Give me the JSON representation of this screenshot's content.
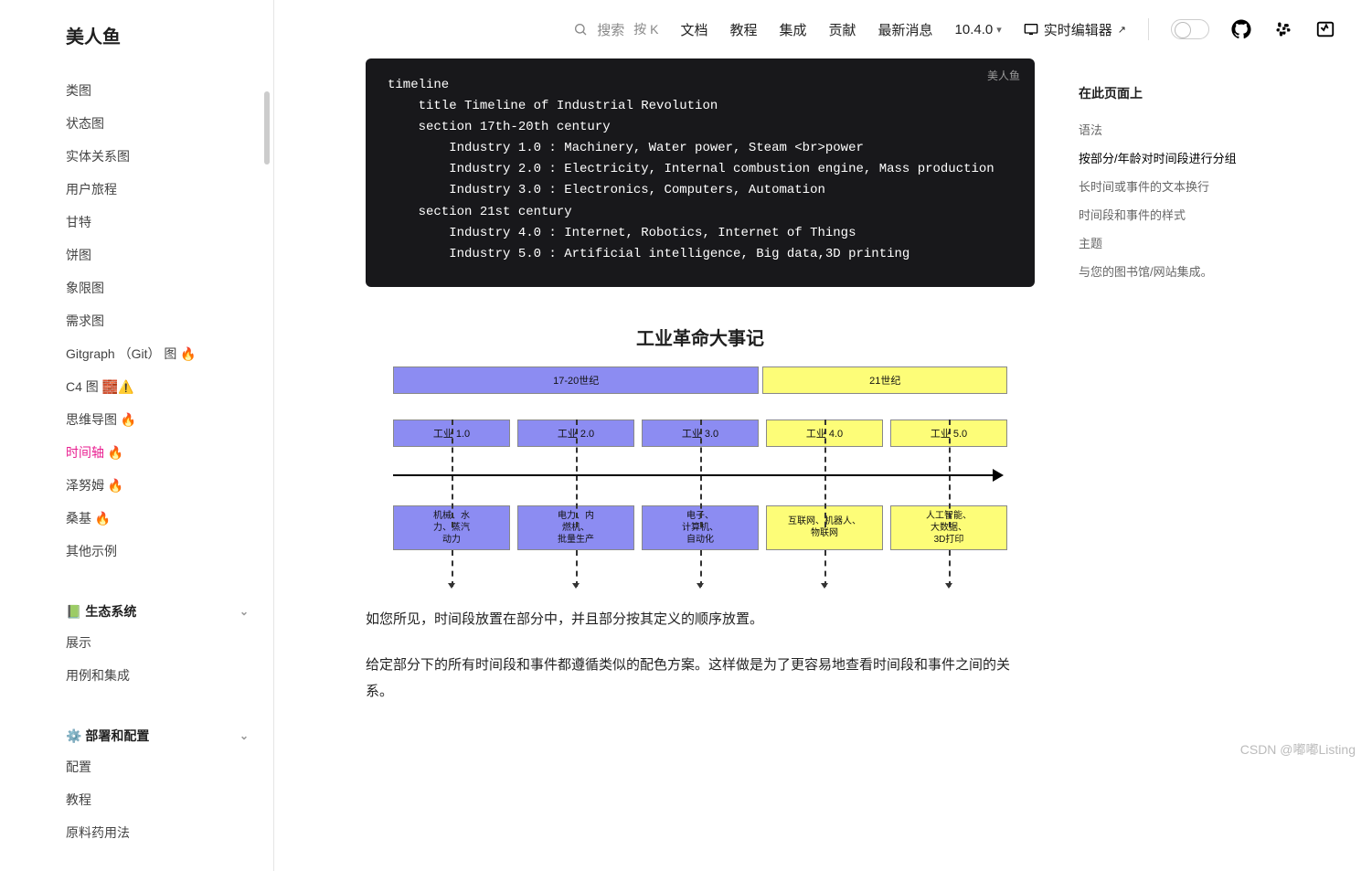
{
  "site_title": "美人鱼",
  "sidebar": {
    "items": [
      {
        "label": "类图"
      },
      {
        "label": "状态图"
      },
      {
        "label": "实体关系图"
      },
      {
        "label": "用户旅程"
      },
      {
        "label": "甘特"
      },
      {
        "label": "饼图"
      },
      {
        "label": "象限图"
      },
      {
        "label": "需求图"
      },
      {
        "label": "Gitgraph （Git） 图 🔥"
      },
      {
        "label": "C4 图 🧱⚠️"
      },
      {
        "label": "思维导图 🔥"
      },
      {
        "label": "时间轴 🔥",
        "active": true
      },
      {
        "label": "泽努姆 🔥"
      },
      {
        "label": "桑基 🔥"
      },
      {
        "label": "其他示例"
      }
    ],
    "sections": [
      {
        "title": "📗 生态系统",
        "items": [
          "展示",
          "用例和集成"
        ]
      },
      {
        "title": "⚙️ 部署和配置",
        "items": [
          "配置",
          "教程",
          "原料药用法"
        ]
      }
    ]
  },
  "topbar": {
    "search_label": "搜索",
    "search_kbd": "按 K",
    "links": [
      "文档",
      "教程",
      "集成",
      "贡献",
      "最新消息"
    ],
    "version": "10.4.0",
    "live_editor": "实时编辑器"
  },
  "code": {
    "badge": "美人鱼",
    "text": "timeline\n    title Timeline of Industrial Revolution\n    section 17th-20th century\n        Industry 1.0 : Machinery, Water power, Steam <br>power\n        Industry 2.0 : Electricity, Internal combustion engine, Mass production\n        Industry 3.0 : Electronics, Computers, Automation\n    section 21st century\n        Industry 4.0 : Internet, Robotics, Internet of Things\n        Industry 5.0 : Artificial intelligence, Big data,3D printing"
  },
  "chart_data": {
    "type": "bar",
    "title": "工业革命大事记",
    "sections": [
      {
        "name": "17-20世纪",
        "color": "purple",
        "span": 3
      },
      {
        "name": "21世纪",
        "color": "yellow",
        "span": 2
      }
    ],
    "periods": [
      {
        "name": "工业 1.0",
        "color": "purple",
        "desc": "机械、水\n力、蒸汽\n动力"
      },
      {
        "name": "工业 2.0",
        "color": "purple",
        "desc": "电力、内\n燃机、\n批量生产"
      },
      {
        "name": "工业 3.0",
        "color": "purple",
        "desc": "电子、\n计算机、\n自动化"
      },
      {
        "name": "工业 4.0",
        "color": "yellow",
        "desc": "互联网、机器人、\n物联网"
      },
      {
        "name": "工业 5.0",
        "color": "yellow",
        "desc": "人工智能、\n大数据、\n3D打印"
      }
    ]
  },
  "prose": {
    "p1": "如您所见，时间段放置在部分中，并且部分按其定义的顺序放置。",
    "p2": "给定部分下的所有时间段和事件都遵循类似的配色方案。这样做是为了更容易地查看时间段和事件之间的关系。"
  },
  "toc": {
    "title": "在此页面上",
    "items": [
      {
        "label": "语法"
      },
      {
        "label": "按部分/年龄对时间段进行分组",
        "active": true
      },
      {
        "label": "长时间或事件的文本换行"
      },
      {
        "label": "时间段和事件的样式"
      },
      {
        "label": "主题"
      },
      {
        "label": "与您的图书馆/网站集成。"
      }
    ]
  },
  "watermark": "CSDN @嘟嘟Listing"
}
